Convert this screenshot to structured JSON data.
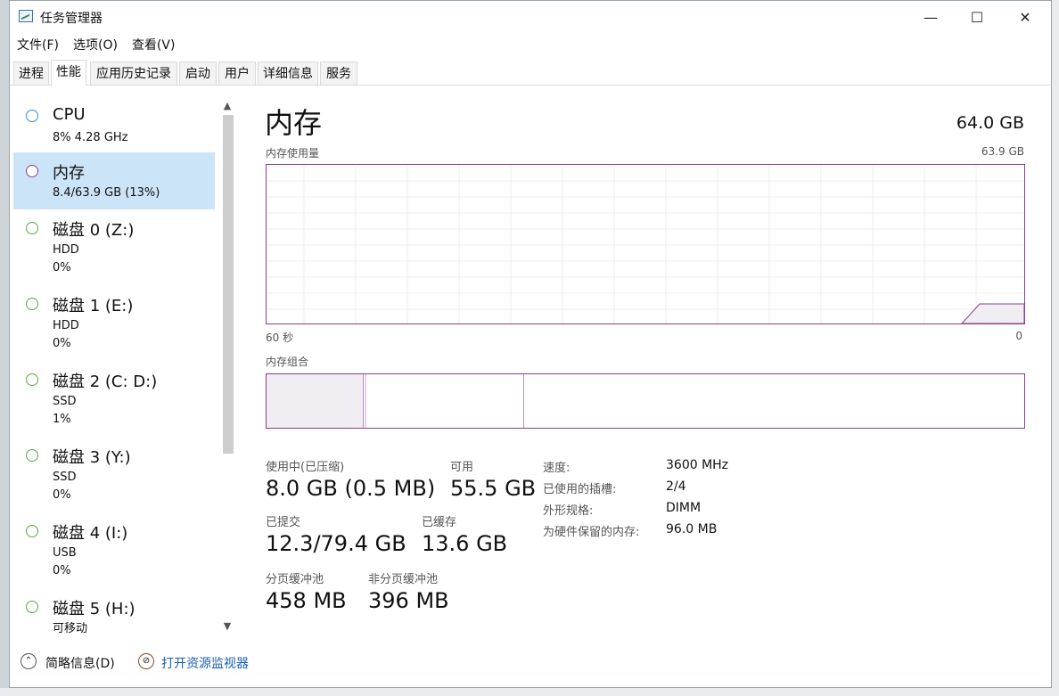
{
  "window": {
    "title": "任务管理器"
  },
  "controls": {
    "minimize": "—",
    "maximize": "☐",
    "close": "✕"
  },
  "menu": [
    "文件(F)",
    "选项(O)",
    "查看(V)"
  ],
  "tabs": [
    "进程",
    "性能",
    "应用历史记录",
    "启动",
    "用户",
    "详细信息",
    "服务"
  ],
  "active_tab": "性能",
  "sidebar": {
    "items": [
      {
        "name": "CPU",
        "sub1": "8% 4.28 GHz",
        "sub2": "",
        "color": "#3b8bd0"
      },
      {
        "name": "内存",
        "sub1": "8.4/63.9 GB (13%)",
        "sub2": "",
        "color": "#8b3f8b"
      },
      {
        "name": "磁盘 0 (Z:)",
        "sub1": "HDD",
        "sub2": "0%",
        "color": "#5aa84a"
      },
      {
        "name": "磁盘 1 (E:)",
        "sub1": "HDD",
        "sub2": "0%",
        "color": "#5aa84a"
      },
      {
        "name": "磁盘 2 (C: D:)",
        "sub1": "SSD",
        "sub2": "1%",
        "color": "#5aa84a"
      },
      {
        "name": "磁盘 3 (Y:)",
        "sub1": "SSD",
        "sub2": "0%",
        "color": "#5aa84a"
      },
      {
        "name": "磁盘 4 (I:)",
        "sub1": "USB",
        "sub2": "0%",
        "color": "#5aa84a"
      },
      {
        "name": "磁盘 5 (H:)",
        "sub1": "可移动",
        "sub2": "",
        "color": "#5aa84a"
      }
    ]
  },
  "main": {
    "title": "内存",
    "total": "64.0 GB",
    "usage_label": "内存使用量",
    "usage_max": "63.9 GB",
    "axis_left": "60 秒",
    "axis_right": "0",
    "composition_label": "内存组合"
  },
  "stats": {
    "in_use_label": "使用中(已压缩)",
    "in_use_value": "8.0 GB (0.5 MB)",
    "available_label": "可用",
    "available_value": "55.5 GB",
    "committed_label": "已提交",
    "committed_value": "12.3/79.4 GB",
    "cached_label": "已缓存",
    "cached_value": "13.6 GB",
    "paged_label": "分页缓冲池",
    "paged_value": "458 MB",
    "nonpaged_label": "非分页缓冲池",
    "nonpaged_value": "396 MB",
    "speed_label": "速度:",
    "speed_value": "3600 MHz",
    "slots_label": "已使用的插槽:",
    "slots_value": "2/4",
    "form_label": "外形规格:",
    "form_value": "DIMM",
    "reserved_label": "为硬件保留的内存:",
    "reserved_value": "96.0 MB"
  },
  "footer": {
    "fewer_details": "简略信息(D)",
    "resource_monitor": "打开资源监视器"
  },
  "accent": {
    "memory": "#8b3f8b",
    "selected": "#cce4f7",
    "link": "#1a5fb4"
  }
}
